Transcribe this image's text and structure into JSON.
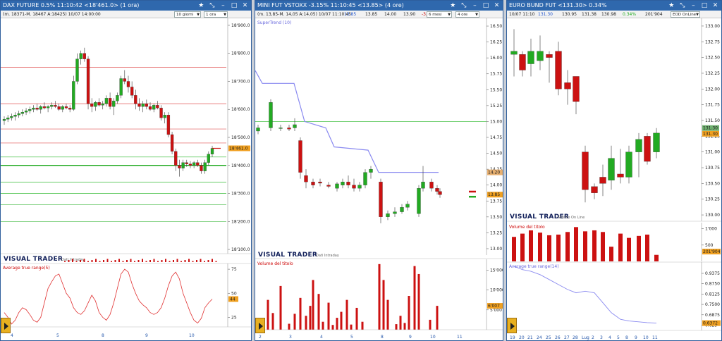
{
  "colors": {
    "title_bar": "#2f68ad",
    "bull": "#22aa22",
    "bear": "#cc1111",
    "supertrend": "#8a8af0",
    "atr": "#e03030",
    "last_price": "#f0a020"
  },
  "brand": {
    "logo": "VISUAL TRADER"
  },
  "panels": [
    {
      "title": "DAX FUTURE 0.5% 11:10:42 <18'461.0> (1 ora)",
      "info": "(m. 18371-M. 18467 A:18425) 10/07 14:00:00",
      "period_select": "10 giorni",
      "interval_select": "1 ora",
      "brand_sub": "Dati Intraday",
      "price_ticks": [
        "18'900.0",
        "18'800.0",
        "18'700.0",
        "18'600.0",
        "18'500.0",
        "18'400.0",
        "18'300.0",
        "18'200.0",
        "18'100.0"
      ],
      "last_price": "18'461.0",
      "indicator_title": "Average true range(5)",
      "indicator_ticks": [
        "75",
        "50",
        "25"
      ],
      "indicator_value": "44",
      "x_labels": [
        "4",
        "5",
        "8",
        "9",
        "10"
      ]
    },
    {
      "title": "MINI FUT VSTOXX -3.15% 11:10:45 <13.85> (4 ore)",
      "info_left": "(m. 13,85-M. 14,05 A:14,05) 10/07 11:10:45",
      "info_values": [
        "13.85",
        "13.85",
        "14.00",
        "13.90",
        "-3."
      ],
      "period_select": "6 mesi",
      "interval_select": "4 ore",
      "overlay_title": "SuperTrend (10)",
      "brand_sub": "Dati Intraday",
      "price_ticks": [
        "16.50",
        "16.25",
        "16.00",
        "15.75",
        "15.50",
        "15.25",
        "15.00",
        "14.75",
        "14.50",
        "14.25",
        "14.00",
        "13.75",
        "13.50",
        "13.25",
        "13.00"
      ],
      "last_price": "13.85",
      "supertrend_price": "14.20",
      "indicator_title": "Volume del titolo",
      "indicator_ticks": [
        "15'000",
        "10'000",
        "5'000"
      ],
      "indicator_value": "6'007",
      "x_labels": [
        "2",
        "3",
        "4",
        "5",
        "8",
        "9",
        "10",
        "11"
      ]
    },
    {
      "title": "EURO BUND FUT <131.30> 0.34%",
      "info_left": "10/07 11:10",
      "info_values": [
        "131.30",
        "130.95",
        "131.38",
        "130.98",
        "0.34%",
        "201'904"
      ],
      "source_select": "EOD OnLine",
      "brand_sub": "Storico On Line",
      "price_ticks": [
        "133.00",
        "132.75",
        "132.50",
        "132.25",
        "132.00",
        "131.75",
        "131.50",
        "131.25",
        "131.00",
        "130.75",
        "130.50",
        "130.25",
        "130.00"
      ],
      "last_price": "131.30",
      "last_price_b": "131.30",
      "indicator_title": "Volume del titolo",
      "indicator_ticks": [
        "1'000",
        "500"
      ],
      "indicator_value": "201'904",
      "indicator2_title": "Average true range(14)",
      "indicator2_ticks": [
        "0.9375",
        "0.8750",
        "0.8125",
        "0.7500",
        "0.6875",
        "0.625"
      ],
      "indicator2_value": "0.6372",
      "x_labels": [
        "19",
        "20",
        "21",
        "24",
        "25",
        "26",
        "27",
        "28",
        "Lug",
        "2",
        "3",
        "4",
        "5",
        "8",
        "9",
        "10",
        "11"
      ]
    }
  ]
}
